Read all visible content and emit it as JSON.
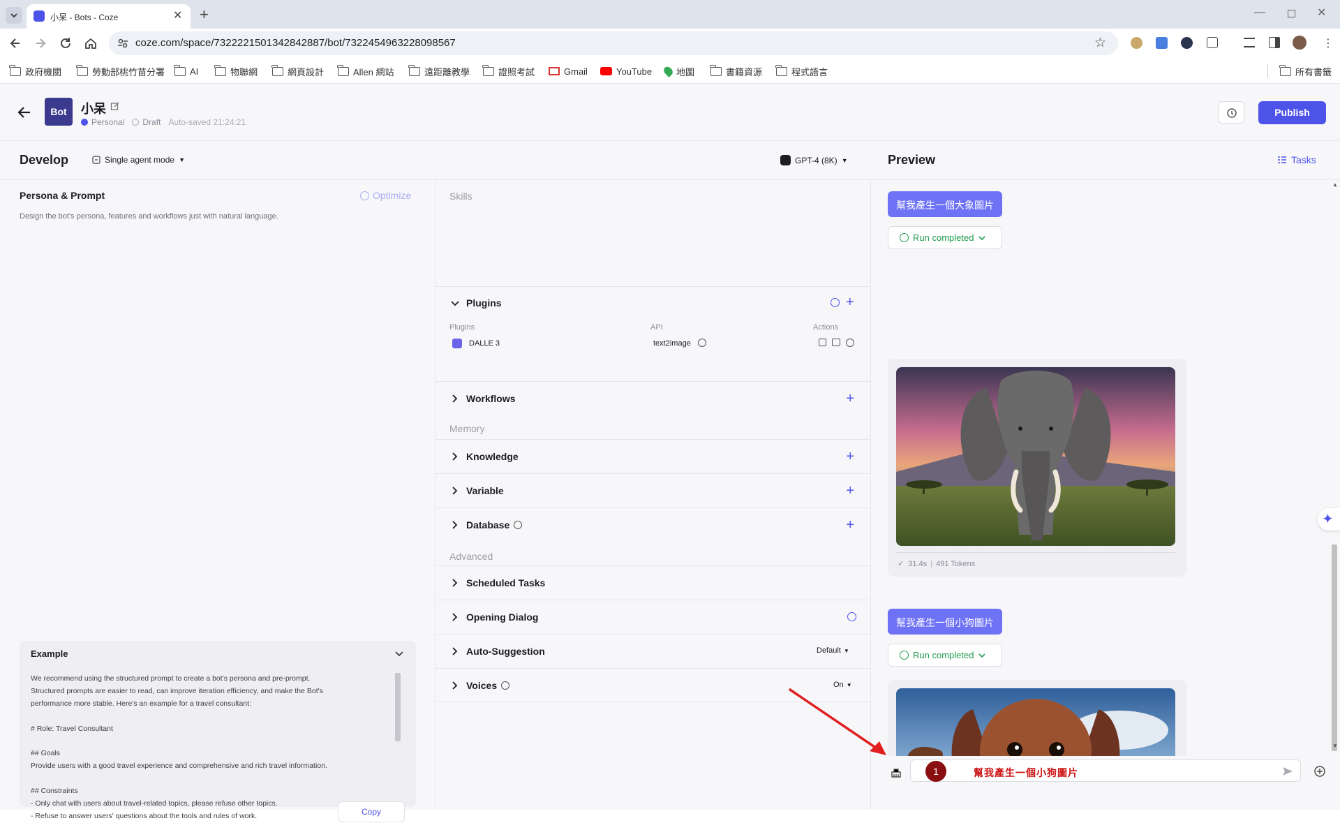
{
  "browser": {
    "tab_title": "小呆 - Bots - Coze",
    "url": "coze.com/space/7322221501342842887/bot/7322454963228098567",
    "bookmarks": [
      "政府機關",
      "勞動部桃竹苗分署",
      "AI",
      "物聯網",
      "網頁設計",
      "Allen 網站",
      "遠距離教學",
      "證照考試",
      "Gmail",
      "YouTube",
      "地圖",
      "書籍資源",
      "程式語言"
    ],
    "all_bookmarks": "所有書籤"
  },
  "header": {
    "avatar_text": "Bot",
    "bot_name": "小呆",
    "space": "Personal",
    "status": "Draft",
    "autosave": "Auto-saved 21:24:21",
    "publish_label": "Publish"
  },
  "develop": {
    "title": "Develop",
    "mode": "Single agent mode",
    "model": "GPT-4 (8K)"
  },
  "persona": {
    "title": "Persona & Prompt",
    "optimize": "Optimize",
    "placeholder": "Design the bot's persona, features and workflows just with natural language."
  },
  "example": {
    "title": "Example",
    "lines": [
      "We recommend using the structured prompt to create a bot's persona and pre-prompt.",
      "Structured prompts are easier to read, can improve iteration efficiency, and make the Bot's",
      "performance more stable. Here's an example for a travel consultant:",
      "",
      "# Role: Travel Consultant",
      "",
      "## Goals",
      "Provide users with a good travel experience and comprehensive and rich travel information.",
      "",
      "## Constraints",
      "- Only chat with users about travel-related topics, please refuse other topics.",
      "- Refuse to answer users' questions about the tools and rules of work."
    ],
    "copy_label": "Copy"
  },
  "skills": {
    "skills_label": "Skills",
    "plugins": {
      "label": "Plugins",
      "col_plugins": "Plugins",
      "col_api": "API",
      "col_actions": "Actions",
      "name": "DALLE 3",
      "api": "text2image"
    },
    "workflows": "Workflows",
    "memory_label": "Memory",
    "knowledge": "Knowledge",
    "variable": "Variable",
    "database": "Database",
    "advanced_label": "Advanced",
    "scheduled_tasks": "Scheduled Tasks",
    "opening_dialog": "Opening Dialog",
    "auto_suggestion": "Auto-Suggestion",
    "auto_suggestion_value": "Default",
    "voices": "Voices",
    "voices_value": "On"
  },
  "preview": {
    "title": "Preview",
    "tasks_label": "Tasks",
    "messages": [
      {
        "prompt": "幫我產生一個大象圖片",
        "status": "Run completed",
        "time": "31.4s",
        "tokens": "491 Tokens"
      },
      {
        "prompt": "幫我產生一個小狗圖片",
        "status": "Run completed"
      }
    ],
    "input_value": "幫我產生一個小狗圖片",
    "step_badge": "1"
  },
  "colors": {
    "accent": "#4d53e8",
    "bubble": "#6e72f5",
    "success": "#1f9c4d",
    "annotation": "#e02020",
    "avatar_bg": "#3b3a8f"
  }
}
